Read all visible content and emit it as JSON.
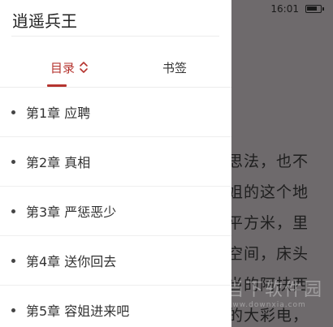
{
  "status_bar": {
    "time": "16:01"
  },
  "reader": {
    "lines": [
      "思法，也不",
      "姐的这个地",
      "平方米，里",
      "空间，床头",
      "当的阿扶西",
      "的大彩电，"
    ]
  },
  "watermark": {
    "text": "当下软件园",
    "url": "www.downxia.com"
  },
  "drawer": {
    "book_title": "逍遥兵王",
    "tabs": {
      "catalog": "目录",
      "bookmark": "书签"
    },
    "chapters": [
      {
        "label": "第1章 应聘"
      },
      {
        "label": "第2章 真相"
      },
      {
        "label": "第3章 严惩恶少"
      },
      {
        "label": "第4章 送你回去"
      },
      {
        "label": "第5章 容姐进来吧"
      }
    ]
  },
  "colors": {
    "accent": "#b5342f",
    "overlay": "#6e6a6c"
  }
}
